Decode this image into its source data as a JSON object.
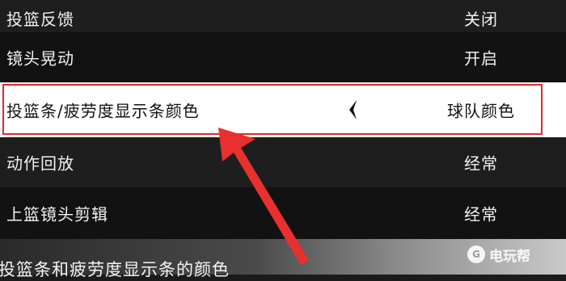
{
  "settings": {
    "rows": [
      {
        "label": "投篮反馈",
        "value": "关闭"
      },
      {
        "label": "镜头晃动",
        "value": "开启"
      },
      {
        "label": "投篮条/疲劳度显示条颜色",
        "value": "球队颜色",
        "selected": true
      },
      {
        "label": "动作回放",
        "value": "经常"
      },
      {
        "label": "上篮镜头剪辑",
        "value": "经常"
      }
    ]
  },
  "description": "投篮条和疲劳度显示条的颜色",
  "watermark": {
    "logo_text": "G",
    "text": "电玩帮"
  },
  "icons": {
    "selector_arrow": "chevron-left-icon",
    "annotation": "red-arrow-icon"
  },
  "colors": {
    "highlight_border": "#e0282b",
    "annotation_arrow": "#e8302f",
    "selected_bg": "#ffffff"
  }
}
